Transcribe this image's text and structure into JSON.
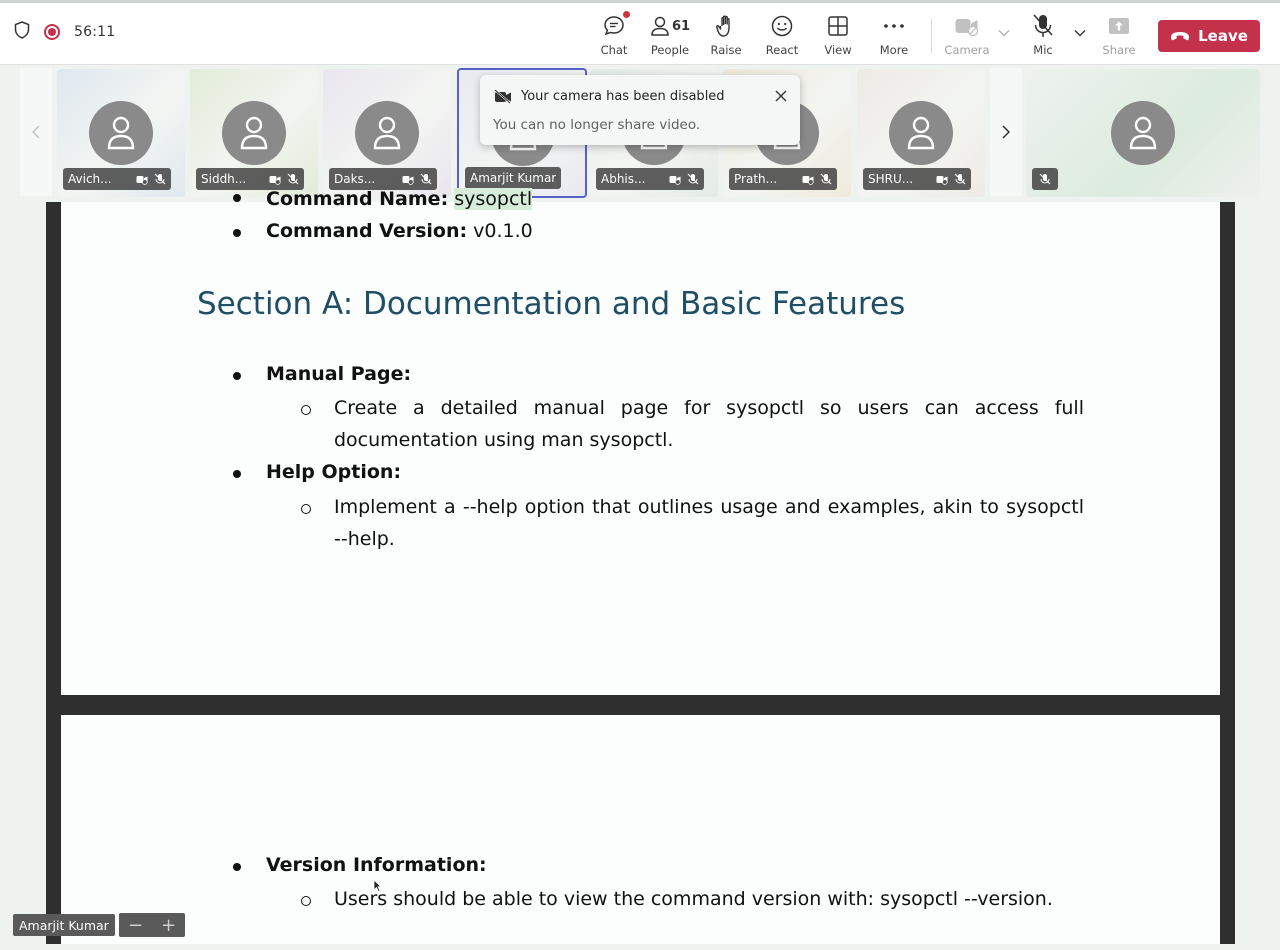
{
  "meeting": {
    "timer": "56:11",
    "people_count": "61"
  },
  "toolbar": {
    "chat": "Chat",
    "people": "People",
    "raise": "Raise",
    "react": "React",
    "view": "View",
    "more": "More",
    "camera": "Camera",
    "mic": "Mic",
    "share": "Share",
    "leave": "Leave"
  },
  "participants": [
    {
      "name": "Avich...",
      "bg": "#dfe8ef"
    },
    {
      "name": "Siddh...",
      "bg": "#e2ecd8"
    },
    {
      "name": "Daks...",
      "bg": "#e9e6ee"
    },
    {
      "name": "Amarjit Kumar",
      "bg": "#e8eaf1"
    },
    {
      "name": "Abhis...",
      "bg": "#e4ebe6"
    },
    {
      "name": "Prath...",
      "bg": "#efeadb"
    },
    {
      "name": "SHRU...",
      "bg": "#eeeae6"
    }
  ],
  "notification": {
    "title": "Your camera has been disabled",
    "message": "You can no longer share video."
  },
  "document": {
    "partial_top": {
      "label": "Command Name:",
      "value": "sysopctl"
    },
    "version_item": {
      "label": "Command Version:",
      "value": "v0.1.0"
    },
    "section_heading": "Section A: Documentation and Basic Features",
    "manual": {
      "label": "Manual Page:",
      "line1": "Create a detailed manual page for sysopctl so users can access full",
      "line2": "documentation using man sysopctl."
    },
    "help": {
      "label": "Help Option:",
      "line1": "Implement a --help option that outlines usage and examples, akin to sysopctl",
      "line2": "--help."
    },
    "version_info": {
      "label": "Version Information:",
      "line1": "Users should be able to view the command version with: sysopctl --version."
    }
  },
  "presenter": {
    "name": "Amarjit Kumar"
  },
  "zoom": {
    "minus": "−",
    "plus": "+"
  },
  "colors": {
    "leave": "#c4314b",
    "active_tile": "#5b5fc7",
    "heading": "#1f4e66"
  }
}
